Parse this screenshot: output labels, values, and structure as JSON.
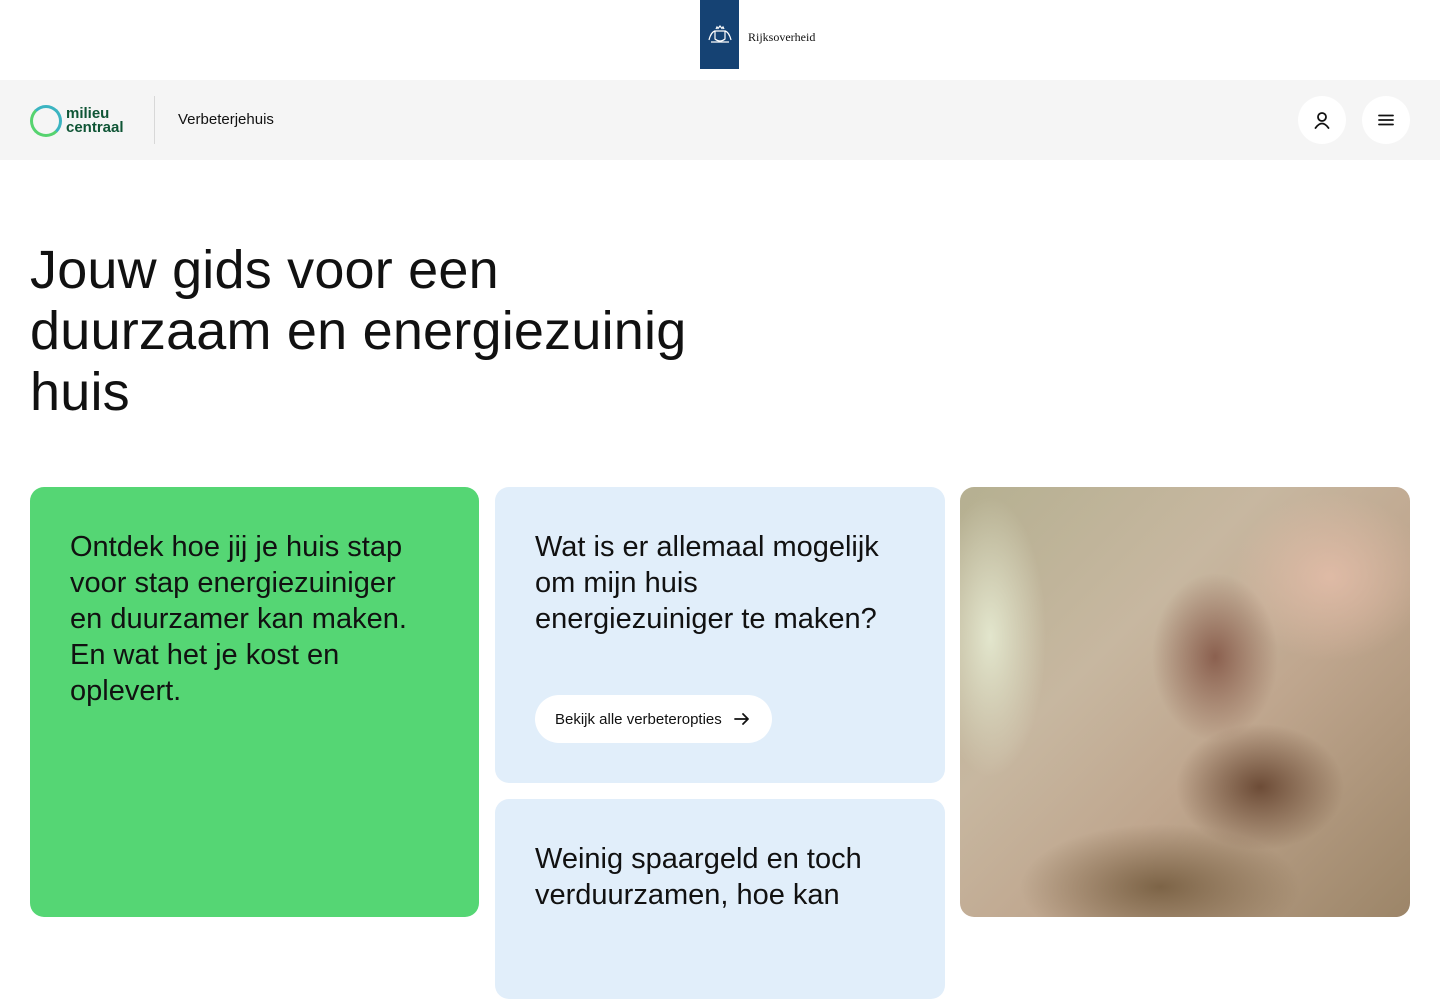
{
  "gov_bar": {
    "name": "Rijksoverheid"
  },
  "header": {
    "logo_line1": "milieu",
    "logo_line2": "centraal",
    "site_title": "Verbeterjehuis",
    "icons": [
      "account-icon",
      "menu-icon"
    ]
  },
  "hero": {
    "title": "Jouw gids voor een duurzaam en energiezuinig huis"
  },
  "cards": {
    "green": {
      "text": "Ontdek hoe jij je huis stap voor stap energiezuiniger en duurzamer kan maken. En wat het je kost en oplevert."
    },
    "blue_1": {
      "text": "Wat is er allemaal mogelijk om mijn huis energiezuiniger te maken?",
      "button_label": "Bekijk alle verbeteropties"
    },
    "blue_2": {
      "text": "Weinig spaargeld en toch verduurzamen, hoe kan"
    }
  },
  "colors": {
    "gov_blue": "#154273",
    "header_bg": "#f5f5f5",
    "green_card": "#55d674",
    "blue_card": "#e1eefa",
    "logo_green": "#0f5535",
    "logo_ring_teal": "#3bb4c1"
  }
}
